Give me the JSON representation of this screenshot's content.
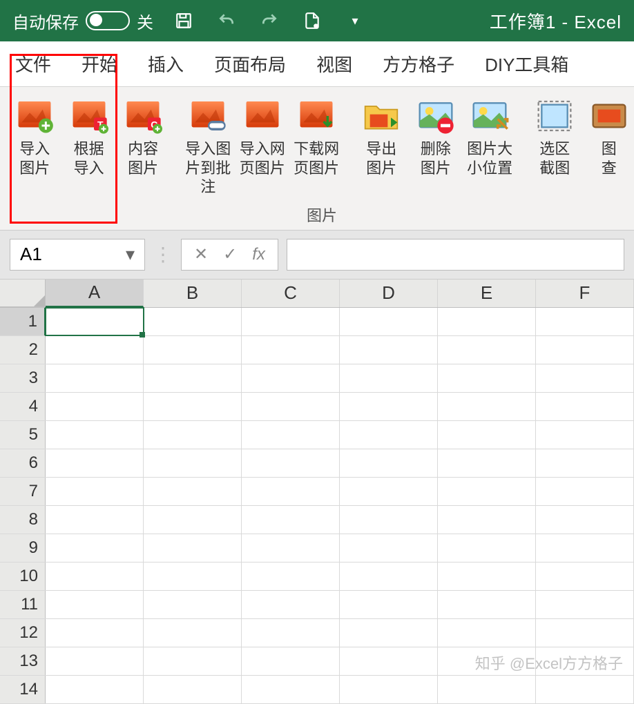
{
  "titlebar": {
    "autosave_label": "自动保存",
    "autosave_state": "关",
    "title": "工作簿1  -  Excel"
  },
  "tabs": [
    "文件",
    "开始",
    "插入",
    "页面布局",
    "视图",
    "方方格子",
    "DIY工具箱"
  ],
  "ribbon": {
    "group_label": "图片",
    "buttons": [
      {
        "label": "导入\n图片",
        "icon": "import-add"
      },
      {
        "label": "根据\n导入",
        "icon": "import-t"
      },
      {
        "label": "内容\n图片",
        "icon": "content-c"
      },
      {
        "label": "导入图\n片到批注",
        "icon": "import-link"
      },
      {
        "label": "导入网\n页图片",
        "icon": "import-web"
      },
      {
        "label": "下载网\n页图片",
        "icon": "download-web"
      },
      {
        "label": "导出\n图片",
        "icon": "export-folder"
      },
      {
        "label": "删除\n图片",
        "icon": "delete-img"
      },
      {
        "label": "图片大\n小位置",
        "icon": "size-pos"
      },
      {
        "label": "选区\n截图",
        "icon": "selection-shot"
      },
      {
        "label": "图\n查",
        "icon": "img-view"
      }
    ]
  },
  "formula_bar": {
    "namebox": "A1",
    "fx": "fx"
  },
  "columns": [
    "A",
    "B",
    "C",
    "D",
    "E",
    "F"
  ],
  "rows": [
    1,
    2,
    3,
    4,
    5,
    6,
    7,
    8,
    9,
    10,
    11,
    12,
    13,
    14
  ],
  "selected_cell": {
    "col": 0,
    "row": 0
  },
  "watermark": "知乎 @Excel方方格子"
}
